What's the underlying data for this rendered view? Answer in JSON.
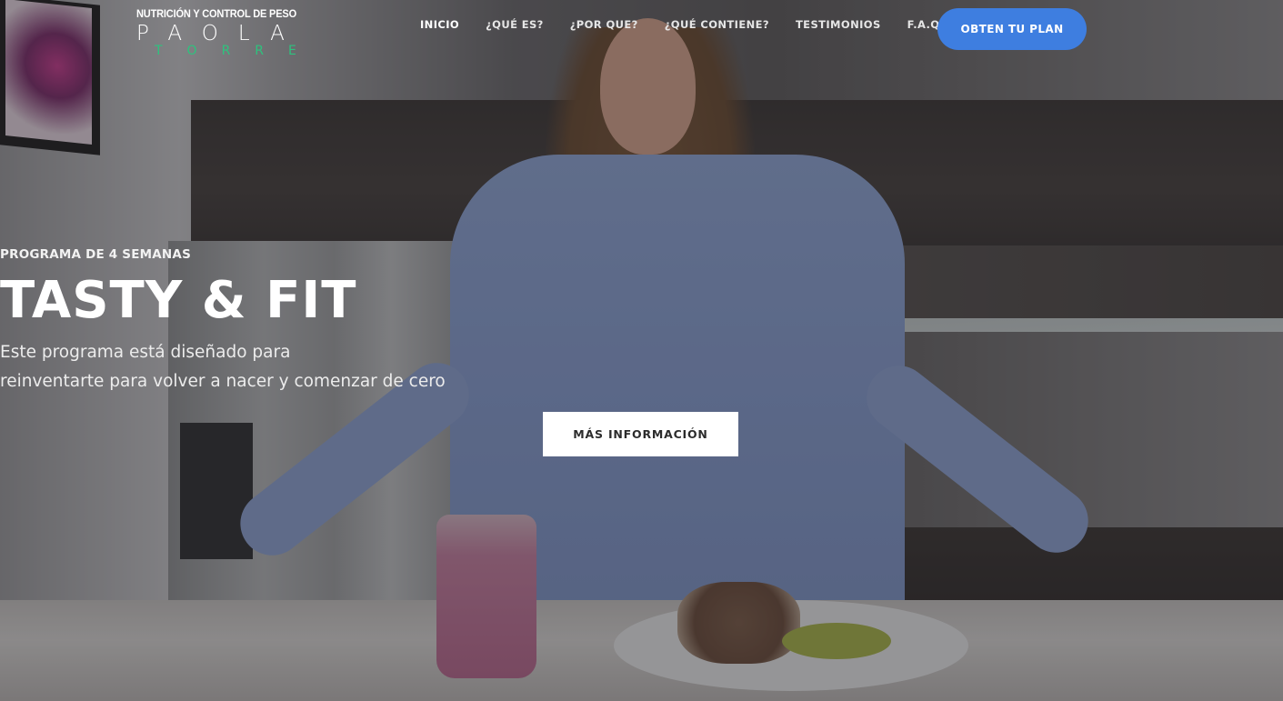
{
  "logo": {
    "tagline": "NUTRICIÓN Y CONTROL DE PESO",
    "first_name": "PAOLA",
    "last_name": "TORRE"
  },
  "nav": {
    "items": [
      {
        "label": "INICIO",
        "active": true
      },
      {
        "label": "¿QUÉ ES?",
        "active": false
      },
      {
        "label": "¿POR QUE?",
        "active": false
      },
      {
        "label": "¿QUÉ CONTIENE?",
        "active": false
      },
      {
        "label": "TESTIMONIOS",
        "active": false
      },
      {
        "label": "F.A.Q.",
        "active": false
      }
    ],
    "cta_label": "OBTEN TU PLAN"
  },
  "hero": {
    "eyebrow": "PROGRAMA DE 4 SEMANAS",
    "title": "TASTY & FIT",
    "subtitle_line1": "Este programa está diseñado para",
    "subtitle_line2": "reinventarte para volver a nacer y comenzar de cero",
    "button_label": "MÁS INFORMACIÓN"
  },
  "colors": {
    "accent": "#3e7ee0",
    "logo_green": "#2ec27e",
    "text": "#ffffff"
  }
}
